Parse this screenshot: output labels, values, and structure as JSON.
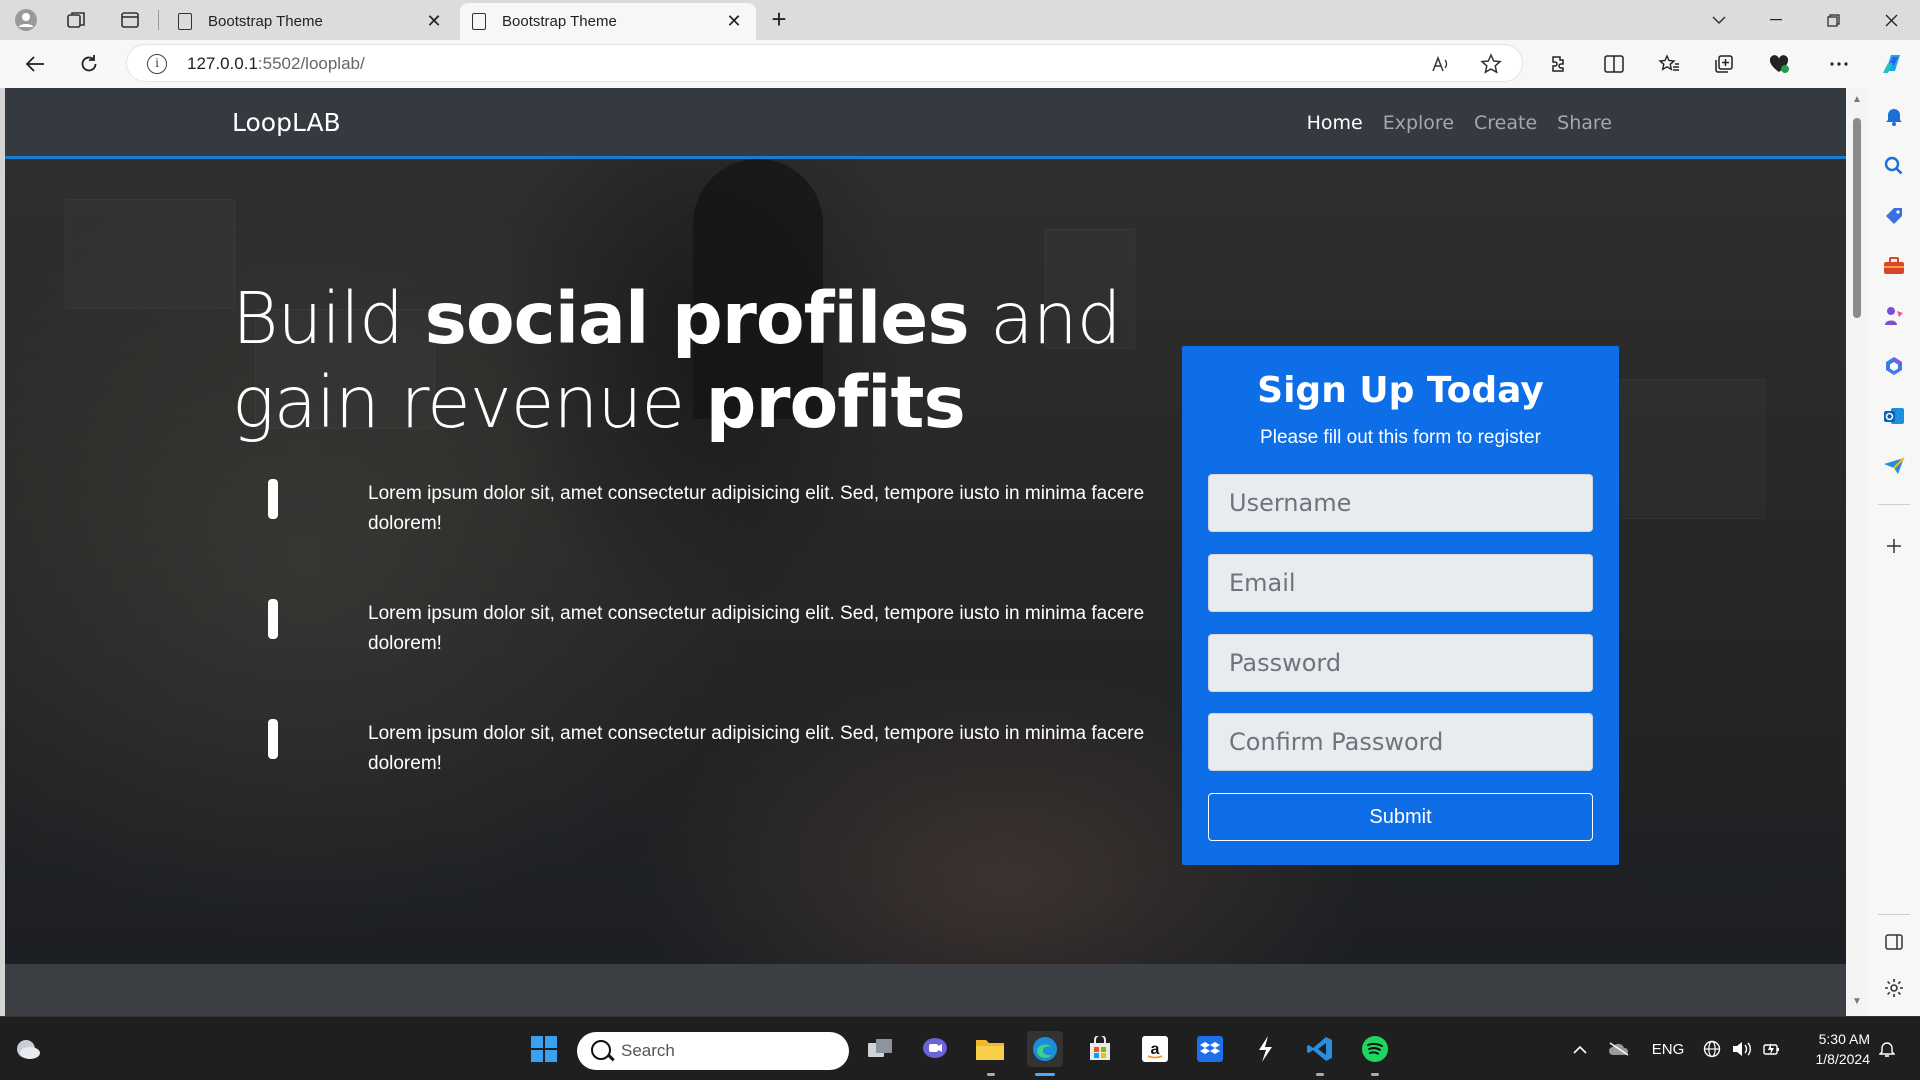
{
  "browser": {
    "tabs": [
      {
        "title": "Bootstrap Theme",
        "active": false
      },
      {
        "title": "Bootstrap Theme",
        "active": true
      }
    ],
    "url_host": "127.0.0.1",
    "url_path": ":5502/looplab/",
    "new_tab_glyph": "+",
    "close_glyph": "✕"
  },
  "site": {
    "brand": "LoopLAB",
    "nav": [
      {
        "label": "Home",
        "active": true
      },
      {
        "label": "Explore",
        "active": false
      },
      {
        "label": "Create",
        "active": false
      },
      {
        "label": "Share",
        "active": false
      }
    ],
    "headline": {
      "part1": "Build ",
      "bold1": "social profiles",
      "part2": " and gain revenue ",
      "bold2": "profits"
    },
    "features": [
      {
        "text": "Lorem ipsum dolor sit, amet consectetur adipisicing elit. Sed, tempore iusto in minima facere dolorem!"
      },
      {
        "text": "Lorem ipsum dolor sit, amet consectetur adipisicing elit. Sed, tempore iusto in minima facere dolorem!"
      },
      {
        "text": "Lorem ipsum dolor sit, amet consectetur adipisicing elit. Sed, tempore iusto in minima facere dolorem!"
      }
    ],
    "signup": {
      "title": "Sign Up Today",
      "subtitle": "Please fill out this form to register",
      "fields": {
        "username": {
          "placeholder": "Username",
          "value": ""
        },
        "email": {
          "placeholder": "Email",
          "value": ""
        },
        "password": {
          "placeholder": "Password",
          "value": ""
        },
        "confirm": {
          "placeholder": "Confirm Password",
          "value": ""
        }
      },
      "submit": "Submit"
    }
  },
  "taskbar": {
    "search_label": "Search",
    "language": "ENG",
    "time": "5:30 AM",
    "date": "1/8/2024"
  },
  "colors": {
    "accent": "#0d6ee8",
    "navbar": "#343a40",
    "nav_border": "#1a7bd6"
  }
}
